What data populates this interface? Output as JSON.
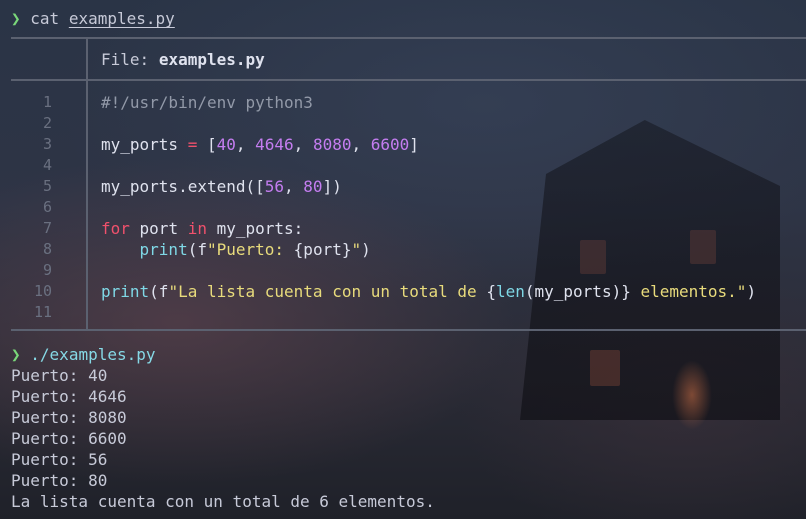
{
  "prompt_symbol": "❯",
  "first_command": {
    "name": "cat",
    "arg": "examples.py"
  },
  "file_header": {
    "label": "File:",
    "filename": "examples.py"
  },
  "line_numbers": [
    "1",
    "2",
    "3",
    "4",
    "5",
    "6",
    "7",
    "8",
    "9",
    "10",
    "11"
  ],
  "code_lines": {
    "l1": "#!/usr/bin/env python3",
    "l3": {
      "a": "my_ports",
      "b": " = [",
      "n1": "40",
      "c1": ", ",
      "n2": "4646",
      "c2": ", ",
      "n3": "8080",
      "c3": ", ",
      "n4": "6600",
      "d": "]"
    },
    "l5": {
      "a": "my_ports.extend([",
      "n1": "56",
      "c": ", ",
      "n2": "80",
      "d": "])"
    },
    "l7": {
      "kw1": "for",
      "a": " port ",
      "kw2": "in",
      "b": " my_ports:"
    },
    "l8": {
      "indent": "    ",
      "fn": "print",
      "a": "(f",
      "s": "\"Puerto: ",
      "br": "{port}",
      "e": "\"",
      "d": ")"
    },
    "l10": {
      "fn": "print",
      "a": "(f",
      "s": "\"La lista cuenta con un total de ",
      "br_open": "{",
      "fn2": "len",
      "inner": "(my_ports)",
      "br_close": "}",
      "s2": " elementos.\"",
      "d": ")"
    }
  },
  "second_command": "./examples.py",
  "output_lines": [
    "Puerto: 40",
    "Puerto: 4646",
    "Puerto: 8080",
    "Puerto: 6600",
    "Puerto: 56",
    "Puerto: 80",
    "La lista cuenta con un total de 6 elementos."
  ],
  "colors": {
    "keyword": "#f0516c",
    "number": "#c47df0",
    "string": "#e8db7c",
    "builtin": "#7fd8e6",
    "prompt": "#7ad77a"
  }
}
